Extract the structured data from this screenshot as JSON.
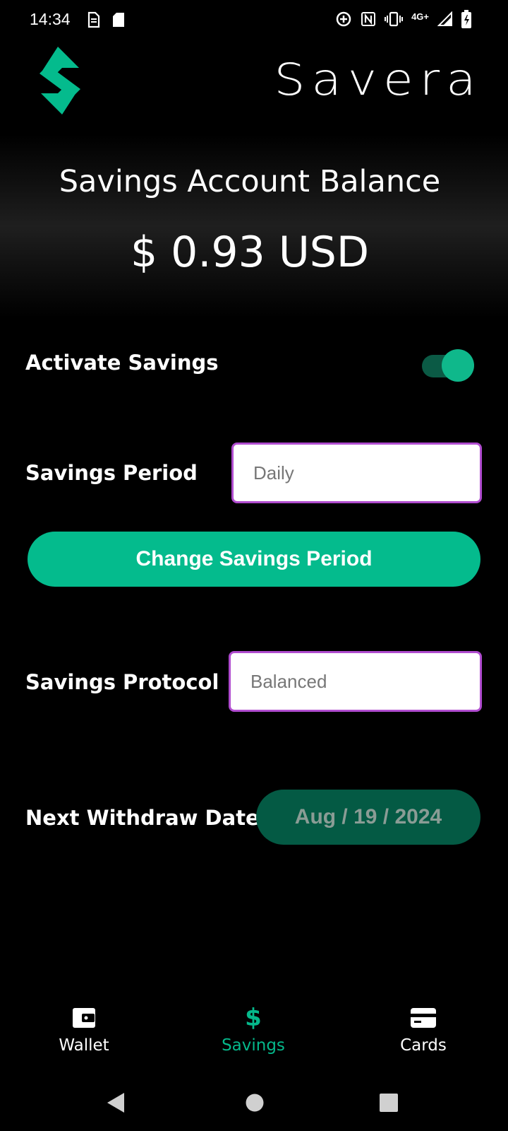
{
  "status_bar": {
    "time": "14:34",
    "network": "4G+",
    "icons": [
      "sim-icon",
      "sd-card-icon",
      "data-saver-icon",
      "nfc-icon",
      "vibrate-icon",
      "signal-icon",
      "battery-icon"
    ]
  },
  "header": {
    "brand": "Savera",
    "logo_icon": "savera-s-logo",
    "accent_color": "#04bb8d"
  },
  "balance": {
    "title": "Savings Account Balance",
    "amount": "$ 0.93 USD"
  },
  "activate": {
    "label": "Activate Savings",
    "enabled": true
  },
  "period": {
    "label": "Savings Period",
    "value": "Daily",
    "change_button": "Change Savings Period"
  },
  "protocol": {
    "label": "Savings Protocol",
    "value": "Balanced"
  },
  "withdraw": {
    "label": "Next Withdraw Date",
    "date": "Aug / 19 / 2024"
  },
  "bottom_nav": {
    "items": [
      {
        "label": "Wallet",
        "icon": "wallet-icon",
        "active": false
      },
      {
        "label": "Savings",
        "icon": "dollar-icon",
        "active": true
      },
      {
        "label": "Cards",
        "icon": "card-icon",
        "active": false
      }
    ],
    "active_color": "#05b88b"
  },
  "system_nav": {
    "buttons": [
      "back-icon",
      "home-icon",
      "recents-icon"
    ]
  }
}
